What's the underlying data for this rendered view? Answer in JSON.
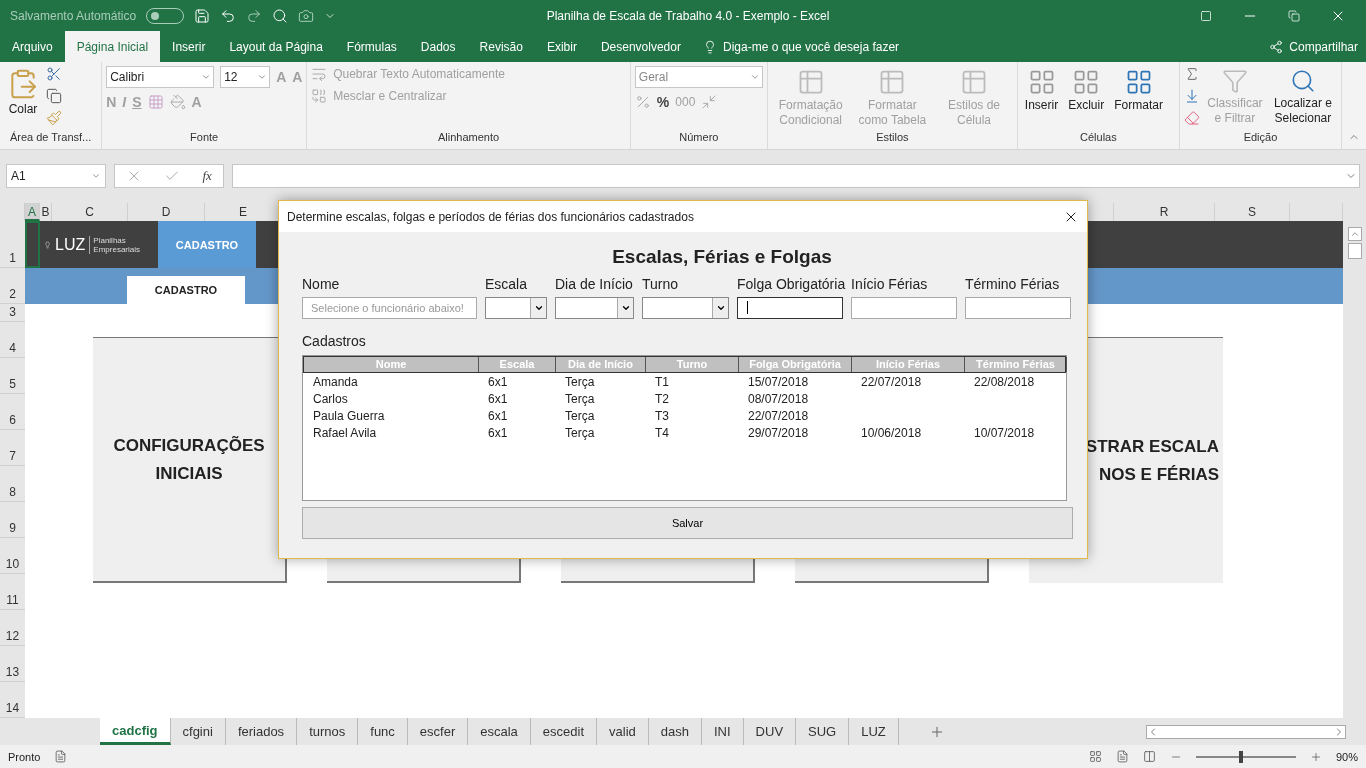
{
  "quick_access": {
    "autosave_label": "Salvamento Automático",
    "autosave_on": false
  },
  "window": {
    "title": "Planilha de Escala de Trabalho 4.0 - Exemplo  -  Excel"
  },
  "menu_tabs": [
    {
      "label": "Arquivo",
      "selected": false
    },
    {
      "label": "Página Inicial",
      "selected": true
    },
    {
      "label": "Inserir",
      "selected": false
    },
    {
      "label": "Layout da Página",
      "selected": false
    },
    {
      "label": "Fórmulas",
      "selected": false
    },
    {
      "label": "Dados",
      "selected": false
    },
    {
      "label": "Revisão",
      "selected": false
    },
    {
      "label": "Exibir",
      "selected": false
    },
    {
      "label": "Desenvolvedor",
      "selected": false
    }
  ],
  "tell_me": "Diga-me o que você deseja fazer",
  "share": "Compartilhar",
  "ribbon": {
    "clipboard": {
      "paste": "Colar",
      "label": "Área de Transf..."
    },
    "font": {
      "name": "Calibri",
      "size": "12",
      "bold": "N",
      "italic": "I",
      "underline": "S",
      "grow": "A",
      "shrink": "A",
      "font_color_button": "A",
      "label": "Fonte"
    },
    "alignment": {
      "wrap": "Quebrar Texto Automaticamente",
      "merge": "Mesclar e Centralizar",
      "label": "Alinhamento"
    },
    "number": {
      "format": "Geral",
      "percent": "%",
      "thousands": "000",
      "label": "Número"
    },
    "styles": {
      "buttons": [
        {
          "label": "Formatação Condicional",
          "disabled": true
        },
        {
          "label": "Formatar como Tabela",
          "disabled": true
        },
        {
          "label": "Estilos de Célula",
          "disabled": true
        }
      ],
      "label": "Estilos"
    },
    "cells": {
      "buttons": [
        {
          "label": "Inserir",
          "disabled": false
        },
        {
          "label": "Excluir",
          "disabled": false
        },
        {
          "label": "Formatar",
          "disabled": false
        }
      ],
      "label": "Células"
    },
    "editing": {
      "sort": {
        "label": "Classificar e Filtrar",
        "disabled": true
      },
      "find": {
        "label": "Localizar e Selecionar",
        "disabled": false
      },
      "label": "Edição"
    }
  },
  "formula_bar": {
    "name_box": "A1",
    "fx": "fx"
  },
  "columns": [
    {
      "label": "A",
      "selected": true
    },
    {
      "label": "B",
      "selected": false
    },
    {
      "label": "C",
      "selected": false
    },
    {
      "label": "D",
      "selected": false
    },
    {
      "label": "E",
      "selected": false
    },
    {
      "label": "R",
      "selected": false
    },
    {
      "label": "S",
      "selected": false
    }
  ],
  "rows": [
    "1",
    "2",
    "3",
    "4",
    "5",
    "6",
    "7",
    "8",
    "9",
    "10",
    "11",
    "12",
    "13",
    "14"
  ],
  "sheet": {
    "logo": "LUZ",
    "logo_sub": "Planilhas Empresariais",
    "nav_tab": "CADASTRO",
    "sub_tab": "CADASTRO",
    "cards": [
      {
        "kind": "text",
        "lines": [
          "CONFIGURAÇÕES",
          "INICIAIS"
        ]
      },
      {
        "kind": "blank"
      },
      {
        "kind": "blank"
      },
      {
        "kind": "blank"
      },
      {
        "kind": "text",
        "lines": [
          "STRAR ESCALA",
          "NOS E FÉRIAS"
        ]
      }
    ]
  },
  "sheet_tabs": [
    {
      "label": "cadcfig",
      "selected": true
    },
    {
      "label": "cfgini",
      "selected": false
    },
    {
      "label": "feriados",
      "selected": false
    },
    {
      "label": "turnos",
      "selected": false
    },
    {
      "label": "func",
      "selected": false
    },
    {
      "label": "escfer",
      "selected": false
    },
    {
      "label": "escala",
      "selected": false
    },
    {
      "label": "escedit",
      "selected": false
    },
    {
      "label": "valid",
      "selected": false
    },
    {
      "label": "dash",
      "selected": false
    },
    {
      "label": "INI",
      "selected": false
    },
    {
      "label": "DUV",
      "selected": false
    },
    {
      "label": "SUG",
      "selected": false
    },
    {
      "label": "LUZ",
      "selected": false
    }
  ],
  "status_bar": {
    "status": "Pronto",
    "zoom": "90%",
    "level": 0.45
  },
  "dialog": {
    "title": "Determine escalas, folgas e períodos de férias dos funcionários cadastrados",
    "heading": "Escalas, Férias e Folgas",
    "fields": [
      {
        "label": "Nome",
        "kind": "text",
        "placeholder": "Selecione o funcionário abaixo!",
        "focused": false
      },
      {
        "label": "Escala",
        "kind": "combo",
        "focused": false
      },
      {
        "label": "Dia de Início",
        "kind": "combo",
        "focused": false
      },
      {
        "label": "Turno",
        "kind": "combo",
        "focused": false
      },
      {
        "label": "Folga Obrigatória",
        "kind": "text",
        "focused": true
      },
      {
        "label": "Início Férias",
        "kind": "text",
        "focused": false
      },
      {
        "label": "Término Férias",
        "kind": "text",
        "focused": false
      }
    ],
    "list_label": "Cadastros",
    "table": {
      "columns": [
        "Nome",
        "Escala",
        "Dia de Início",
        "Turno",
        "Folga Obrigatória",
        "Início Férias",
        "Término Férias"
      ],
      "rows": [
        [
          "Amanda",
          "6x1",
          "Terça",
          "T1",
          "15/07/2018",
          "22/07/2018",
          "22/08/2018"
        ],
        [
          "Carlos",
          "6x1",
          "Terça",
          "T2",
          "08/07/2018",
          "",
          ""
        ],
        [
          "Paula Guerra",
          "6x1",
          "Terça",
          "T3",
          "22/07/2018",
          "",
          ""
        ],
        [
          "Rafael Avila",
          "6x1",
          "Terça",
          "T4",
          "29/07/2018",
          "10/06/2018",
          "10/07/2018"
        ]
      ]
    },
    "save_button": "Salvar"
  }
}
